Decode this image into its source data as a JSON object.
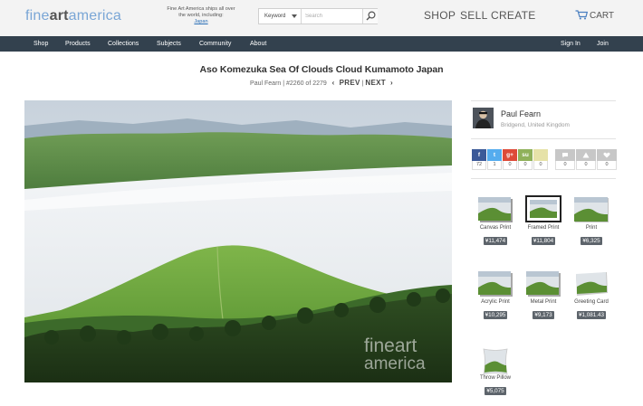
{
  "header": {
    "logo_prefix": "fine",
    "logo_bold": "art",
    "logo_suffix": "america",
    "ships_text": "Fine Art America ships all over the world, including:",
    "ships_country": "Japan",
    "search_scope": "Keyword",
    "search_placeholder": "Search",
    "nav": [
      "SHOP",
      "SELL",
      "CREATE"
    ],
    "cart_label": "CART"
  },
  "navbar": {
    "left": [
      "Shop",
      "Products",
      "Collections",
      "Subjects",
      "Community",
      "About"
    ],
    "right": [
      "Sign In",
      "Join"
    ]
  },
  "artwork": {
    "title": "Aso Komezuka Sea Of Clouds Cloud Kumamoto Japan",
    "artist": "Paul Fearn",
    "position": "#2260 of 2279",
    "prev_label": "PREV",
    "next_label": "NEXT",
    "watermark_line1": "fineart",
    "watermark_line2": "america"
  },
  "artist_panel": {
    "name": "Paul Fearn",
    "location": "Bridgend, United Kingdom"
  },
  "social": [
    {
      "icon": "f",
      "count": "72",
      "color": "#3b5998",
      "name": "facebook"
    },
    {
      "icon": "t",
      "count": "1",
      "color": "#55acee",
      "name": "twitter"
    },
    {
      "icon": "g+",
      "count": "0",
      "color": "#dd4b39",
      "name": "google-plus"
    },
    {
      "icon": "su",
      "count": "0",
      "color": "#8fb15a",
      "name": "stumbleupon"
    },
    {
      "icon": "",
      "count": "0",
      "color": "#e6e2a8",
      "name": "share"
    }
  ],
  "actions": [
    {
      "count": "0",
      "name": "comment"
    },
    {
      "count": "0",
      "name": "favorite"
    },
    {
      "count": "0",
      "name": "like"
    }
  ],
  "products": [
    {
      "name": "Canvas Print",
      "price": "¥11,474"
    },
    {
      "name": "Framed Print",
      "price": "¥11,804"
    },
    {
      "name": "Print",
      "price": "¥6,325"
    },
    {
      "name": "Acrylic Print",
      "price": "¥10,295"
    },
    {
      "name": "Metal Print",
      "price": "¥9,173"
    },
    {
      "name": "Greeting Card",
      "price": "¥1,081.43"
    },
    {
      "name": "Throw Pillow",
      "price": "¥5,075"
    }
  ]
}
